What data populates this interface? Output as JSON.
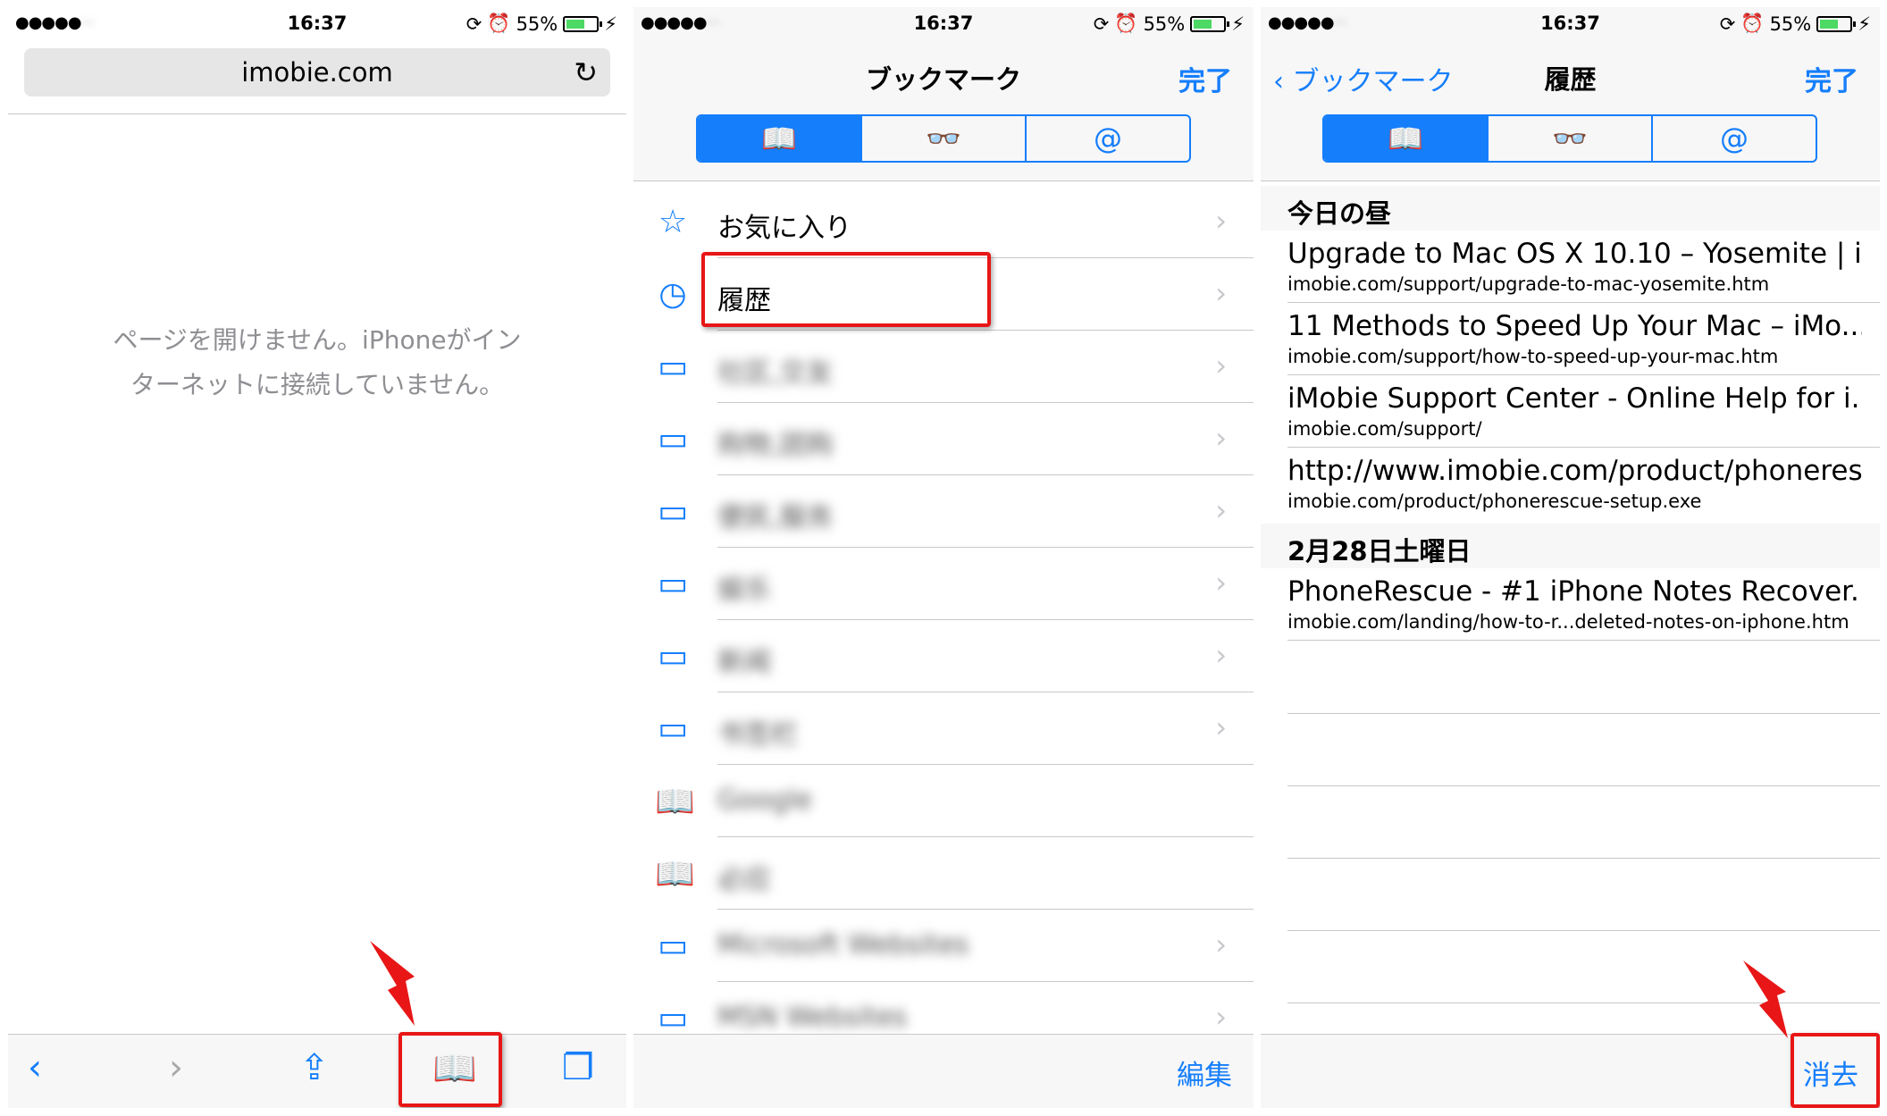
{
  "status": {
    "signal": "●●●●●",
    "time": "16:37",
    "battery": "55%"
  },
  "screen1": {
    "url": "imobie.com",
    "error_message": "ページを開けません。iPhoneがインターネットに接続していません。",
    "error_line1": "ページを開けません。iPhoneがイン",
    "error_line2": "ターネットに接続していません。"
  },
  "screen2": {
    "title": "ブックマーク",
    "done": "完了",
    "edit": "編集",
    "items": [
      {
        "label": "お気に入り",
        "icon": "star-icon"
      },
      {
        "label": "履歴",
        "icon": "clock-icon"
      },
      {
        "label": "社区,交友",
        "icon": "folder-icon"
      },
      {
        "label": "购物,团购",
        "icon": "folder-icon"
      },
      {
        "label": "便民,服务",
        "icon": "folder-icon"
      },
      {
        "label": "娱乐",
        "icon": "folder-icon"
      },
      {
        "label": "新闻",
        "icon": "folder-icon"
      },
      {
        "label": "书签栏",
        "icon": "folder-icon"
      },
      {
        "label": "Google",
        "icon": "book-icon"
      },
      {
        "label": "必应",
        "icon": "book-icon"
      },
      {
        "label": "Microsoft Websites",
        "icon": "folder-icon"
      },
      {
        "label": "MSN Websites",
        "icon": "folder-icon"
      }
    ]
  },
  "screen3": {
    "back": "ブックマーク",
    "title": "履歴",
    "done": "完了",
    "clear": "消去",
    "section1": "今日の昼",
    "section2": "2月28日土曜日",
    "rows": [
      {
        "title": "Upgrade to Mac OS X 10.10 – Yosemite | i...",
        "url": "imobie.com/support/upgrade-to-mac-yosemite.htm"
      },
      {
        "title": "11 Methods to Speed Up Your Mac – iMo...",
        "url": "imobie.com/support/how-to-speed-up-your-mac.htm"
      },
      {
        "title": "iMobie Support Center - Online Help for i...",
        "url": "imobie.com/support/"
      },
      {
        "title": "http://www.imobie.com/product/phoneres...",
        "url": "imobie.com/product/phonerescue-setup.exe"
      },
      {
        "title": "PhoneRescue - #1 iPhone Notes Recover...",
        "url": "imobie.com/landing/how-to-r...deleted-notes-on-iphone.htm"
      }
    ]
  },
  "colors": {
    "accent": "#157efb",
    "highlight": "#e81616"
  }
}
